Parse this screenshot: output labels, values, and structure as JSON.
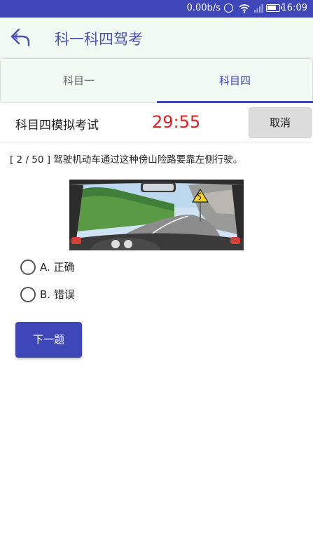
{
  "status_bar": {
    "speed": "0.00b/s",
    "time": "16:09"
  },
  "header": {
    "title": "科一科四驾考"
  },
  "tabs": [
    {
      "label": "科目一",
      "active": false
    },
    {
      "label": "科目四",
      "active": true
    }
  ],
  "exam": {
    "title": "科目四模拟考试",
    "timer": "29:55",
    "cancel_label": "取消"
  },
  "question": {
    "text": "[ 2 / 50 ] 驾驶机动车通过这种傍山险路要靠左侧行驶。"
  },
  "options": [
    {
      "label": "A. 正确",
      "selected": false
    },
    {
      "label": "B. 错误",
      "selected": false
    }
  ],
  "next_label": "下一题",
  "colors": {
    "primary": "#3f47b8",
    "header_bg": "#f2fbf3",
    "timer": "#e02020",
    "cancel_bg": "#dcdcdc"
  }
}
